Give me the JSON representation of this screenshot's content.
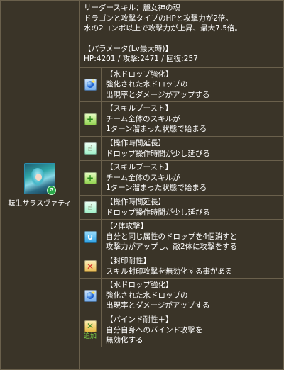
{
  "monster": {
    "name": "転生サラスヴァティ",
    "badge": "G"
  },
  "header": {
    "leader_skill": "リーダースキル：麗女神の魂",
    "leader_line1": "ドラゴンと攻撃タイプのHPと攻撃力が2倍。",
    "leader_line2": "水の2コンボ以上で攻撃力が上昇、最大7.5倍。",
    "param_title": "【パラメータ(Lv最大時)】",
    "params": "HP:4201 / 攻撃:2471 / 回復:257"
  },
  "awakenings": [
    {
      "icon": "water-drop-enhance-icon",
      "title": "【水ドロップ強化】",
      "line1": "強化された水ドロップの",
      "line2": "出現率とダメージがアップする"
    },
    {
      "icon": "skill-boost-icon",
      "title": "【スキルブースト】",
      "line1": "チーム全体のスキルが",
      "line2": "1ターン溜まった状態で始まる"
    },
    {
      "icon": "extend-time-icon",
      "title": "【操作時間延長】",
      "line1": "ドロップ操作時間が少し延びる",
      "line2": ""
    },
    {
      "icon": "skill-boost-icon",
      "title": "【スキルブースト】",
      "line1": "チーム全体のスキルが",
      "line2": "1ターン溜まった状態で始まる"
    },
    {
      "icon": "extend-time-icon",
      "title": "【操作時間延長】",
      "line1": "ドロップ操作時間が少し延びる",
      "line2": ""
    },
    {
      "icon": "two-pronged-attack-icon",
      "title": "【2体攻撃】",
      "line1": "自分と同じ属性のドロップを4個消すと",
      "line2": "攻撃力がアップし、敵2体に攻撃をする"
    },
    {
      "icon": "resist-skill-bind-icon",
      "title": "【封印耐性】",
      "line1": "スキル封印攻撃を無効化する事がある",
      "line2": ""
    },
    {
      "icon": "water-drop-enhance-icon",
      "title": "【水ドロップ強化】",
      "line1": "強化された水ドロップの",
      "line2": "出現率とダメージがアップする"
    },
    {
      "icon": "bind-resist-plus-icon",
      "title": "【バインド耐性＋】",
      "line1": "自分自身へのバインド攻撃を",
      "line2": "無効化する",
      "tag": "追加"
    }
  ]
}
